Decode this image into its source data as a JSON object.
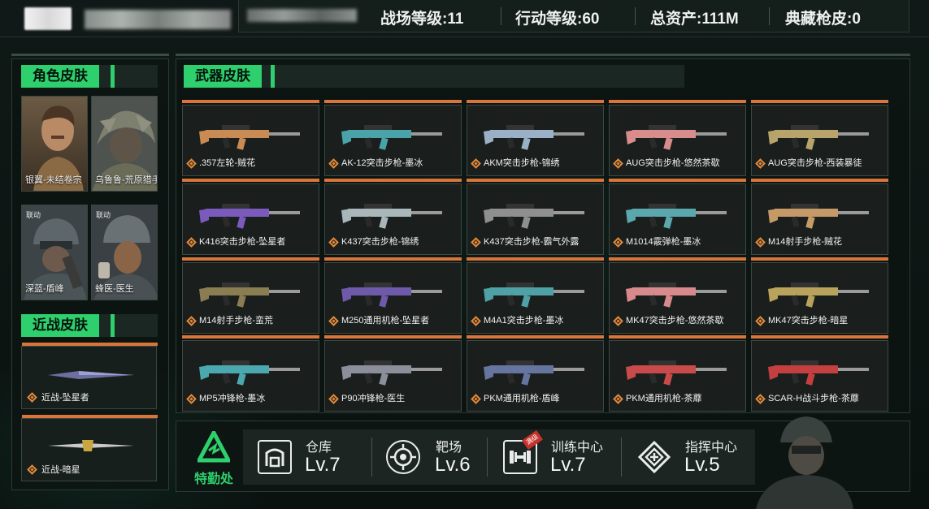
{
  "header": {
    "stats": [
      {
        "label": "战场等级:",
        "value": "11"
      },
      {
        "label": "行动等级:",
        "value": "60"
      },
      {
        "label": "总资产:",
        "value": "111M"
      },
      {
        "label": "典藏枪皮:",
        "value": "0"
      }
    ]
  },
  "character_skins": {
    "title": "角色皮肤",
    "items": [
      {
        "name": "银翼-未结卷宗",
        "tag": ""
      },
      {
        "name": "乌鲁鲁-荒原猎手",
        "tag": ""
      },
      {
        "name": "深蓝-盾峰",
        "tag": "联动"
      },
      {
        "name": "蜂医-医生",
        "tag": "联动"
      }
    ]
  },
  "melee_skins": {
    "title": "近战皮肤",
    "items": [
      {
        "name": "近战-坠星者"
      },
      {
        "name": "近战-暗星"
      }
    ]
  },
  "weapon_skins": {
    "title": "武器皮肤",
    "items": [
      {
        "name": ".357左轮-贼花",
        "color": "#c98b54"
      },
      {
        "name": "AK-12突击步枪-墨冰",
        "color": "#4aa3a8"
      },
      {
        "name": "AKM突击步枪-锦绣",
        "color": "#9ab0c6"
      },
      {
        "name": "AUG突击步枪-悠然茶歇",
        "color": "#d98c8c"
      },
      {
        "name": "AUG突击步枪-西装暴徒",
        "color": "#b8a46a"
      },
      {
        "name": "K416突击步枪-坠星者",
        "color": "#7a5bbd"
      },
      {
        "name": "K437突击步枪-锦绣",
        "color": "#a9b6ba"
      },
      {
        "name": "K437突击步枪-霸气外露",
        "color": "#8f8f8f"
      },
      {
        "name": "M1014霰弹枪-墨冰",
        "color": "#5aa7ad"
      },
      {
        "name": "M14射手步枪-贼花",
        "color": "#c59a66"
      },
      {
        "name": "M14射手步枪-蛮荒",
        "color": "#8a7d52"
      },
      {
        "name": "M250通用机枪-坠星者",
        "color": "#6e5aa8"
      },
      {
        "name": "M4A1突击步枪-墨冰",
        "color": "#4fa1a6"
      },
      {
        "name": "MK47突击步枪-悠然茶歇",
        "color": "#d8898b"
      },
      {
        "name": "MK47突击步枪-暗星",
        "color": "#b9a25c"
      },
      {
        "name": "MP5冲锋枪-墨冰",
        "color": "#4aa8ae"
      },
      {
        "name": "P90冲锋枪-医生",
        "color": "#8b8f99"
      },
      {
        "name": "PKM通用机枪-盾峰",
        "color": "#6675a0"
      },
      {
        "name": "PKM通用机枪-茶蘼",
        "color": "#c94a4a"
      },
      {
        "name": "SCAR-H战斗步枪-茶蘼",
        "color": "#c43f3f"
      }
    ]
  },
  "bottom": {
    "brand": "特勤处",
    "facilities": [
      {
        "name": "仓库",
        "level": "Lv.7",
        "icon": "warehouse-icon"
      },
      {
        "name": "靶场",
        "level": "Lv.6",
        "icon": "target-icon"
      },
      {
        "name": "训练中心",
        "level": "Lv.7",
        "icon": "dumbbell-icon",
        "badge": "满级"
      },
      {
        "name": "指挥中心",
        "level": "Lv.5",
        "icon": "command-icon"
      }
    ]
  },
  "colors": {
    "accent": "#2ecf6d",
    "card_top": "#d9743a",
    "rarity_icon": "#e58a3a"
  }
}
